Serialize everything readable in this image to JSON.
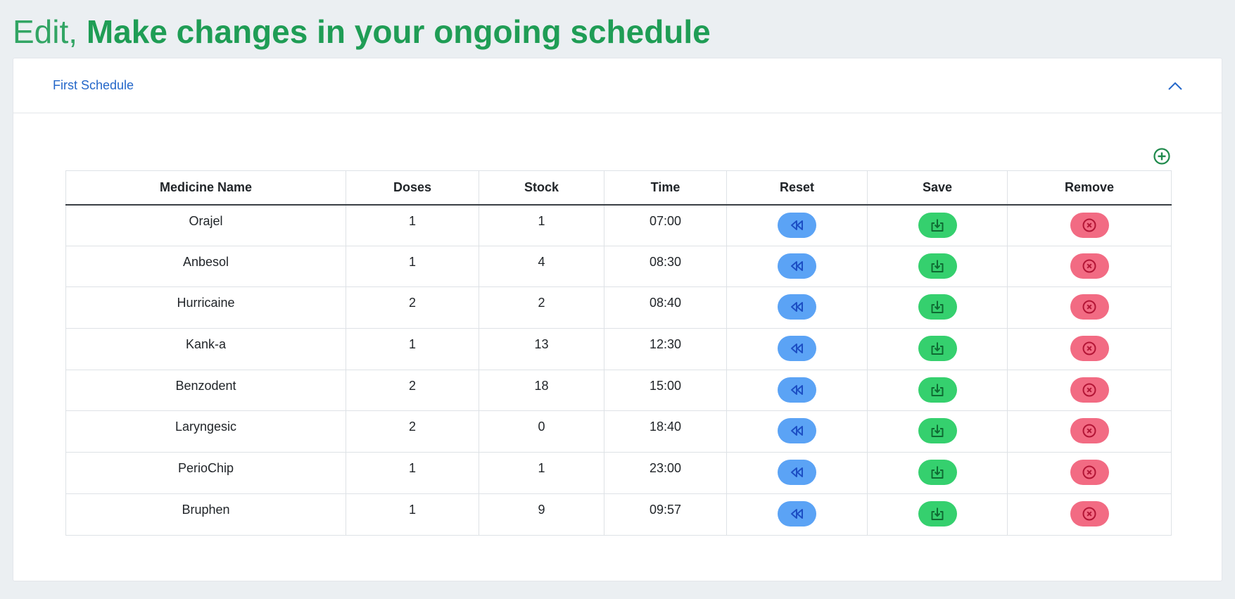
{
  "header": {
    "prefix": "Edit,",
    "title": "Make changes in your ongoing schedule"
  },
  "schedule": {
    "title": "First Schedule",
    "collapse_icon": "chevron-up-icon",
    "add_icon": "plus-circle-icon"
  },
  "table": {
    "columns": [
      "Medicine Name",
      "Doses",
      "Stock",
      "Time",
      "Reset",
      "Save",
      "Remove"
    ],
    "rows": [
      {
        "name": "Orajel",
        "doses": "1",
        "stock": "1",
        "time": "07:00"
      },
      {
        "name": "Anbesol",
        "doses": "1",
        "stock": "4",
        "time": "08:30"
      },
      {
        "name": "Hurricaine",
        "doses": "2",
        "stock": "2",
        "time": "08:40"
      },
      {
        "name": "Kank-a",
        "doses": "1",
        "stock": "13",
        "time": "12:30"
      },
      {
        "name": "Benzodent",
        "doses": "2",
        "stock": "18",
        "time": "15:00"
      },
      {
        "name": "Laryngesic",
        "doses": "2",
        "stock": "0",
        "time": "18:40"
      },
      {
        "name": "PerioChip",
        "doses": "1",
        "stock": "1",
        "time": "23:00"
      },
      {
        "name": "Bruphen",
        "doses": "1",
        "stock": "9",
        "time": "09:57"
      }
    ],
    "action_icons": {
      "reset": "rewind-icon",
      "save": "download-icon",
      "remove": "x-circle-icon"
    }
  },
  "colors": {
    "title_green": "#1f9d55",
    "link_blue": "#2467c9",
    "reset": "#5ba3f5",
    "save": "#35d06e",
    "remove": "#f26b83"
  }
}
